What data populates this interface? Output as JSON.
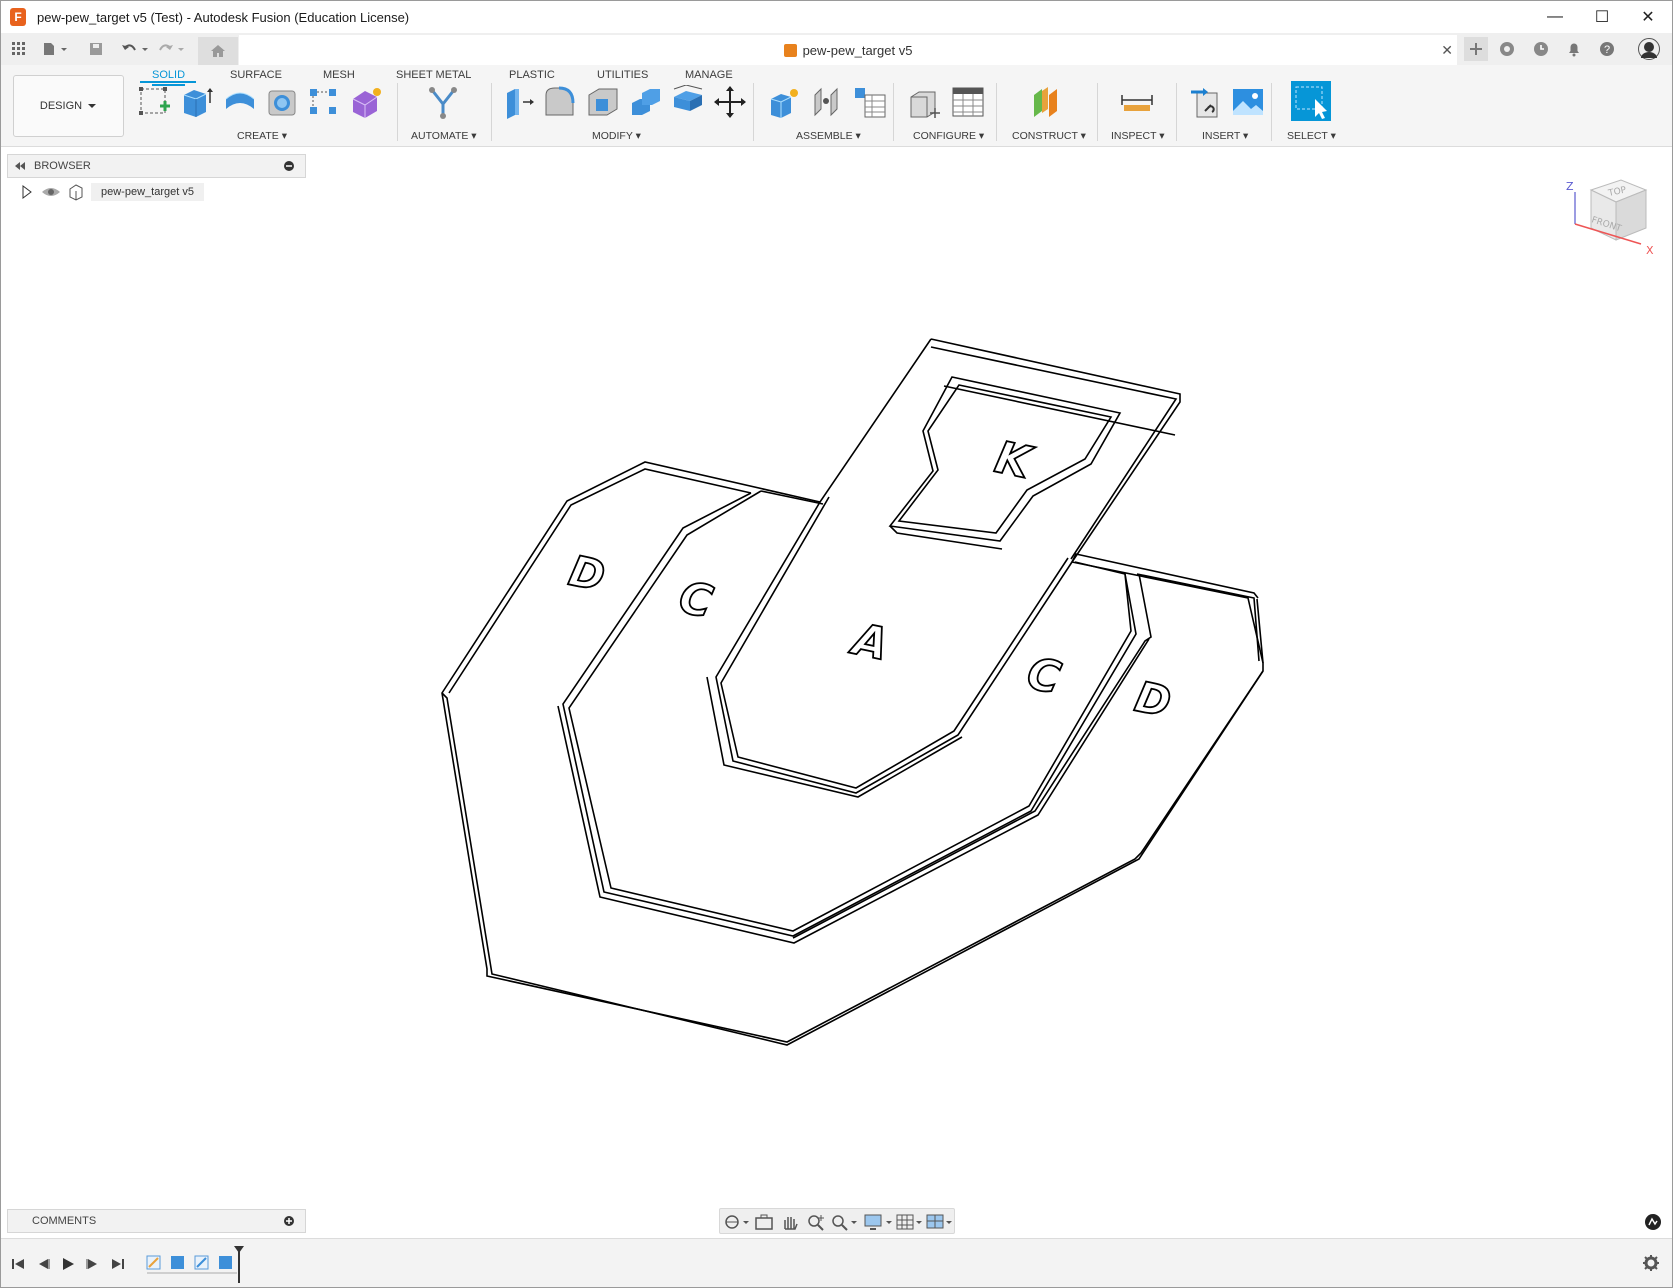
{
  "window": {
    "title": "pew-pew_target v5 (Test) - Autodesk Fusion (Education License)",
    "logo_letter": "F",
    "minimize": "—",
    "maximize": "☐",
    "close": "✕"
  },
  "doc_tab": {
    "label": "pew-pew_target v5",
    "close": "✕"
  },
  "ribbon": {
    "workspace": "DESIGN",
    "tabs": [
      "SOLID",
      "SURFACE",
      "MESH",
      "SHEET METAL",
      "PLASTIC",
      "UTILITIES",
      "MANAGE"
    ],
    "active_tab": "SOLID",
    "groups": [
      "CREATE",
      "AUTOMATE",
      "MODIFY",
      "ASSEMBLE",
      "CONFIGURE",
      "CONSTRUCT",
      "INSPECT",
      "INSERT",
      "SELECT"
    ]
  },
  "browser": {
    "title": "BROWSER",
    "root_item": "pew-pew_target v5"
  },
  "comments": {
    "title": "COMMENTS"
  },
  "viewcube": {
    "top": "TOP",
    "front": "FRONT",
    "axis_z": "Z",
    "axis_x": "X"
  },
  "model": {
    "labels": {
      "king": "K",
      "alpha": "A",
      "charlie_left": "C",
      "charlie_right": "C",
      "delta_left": "D",
      "delta_right": "D"
    }
  },
  "colors": {
    "accent": "#0696d7",
    "fusion_orange": "#e8621d",
    "line": "#000000"
  }
}
